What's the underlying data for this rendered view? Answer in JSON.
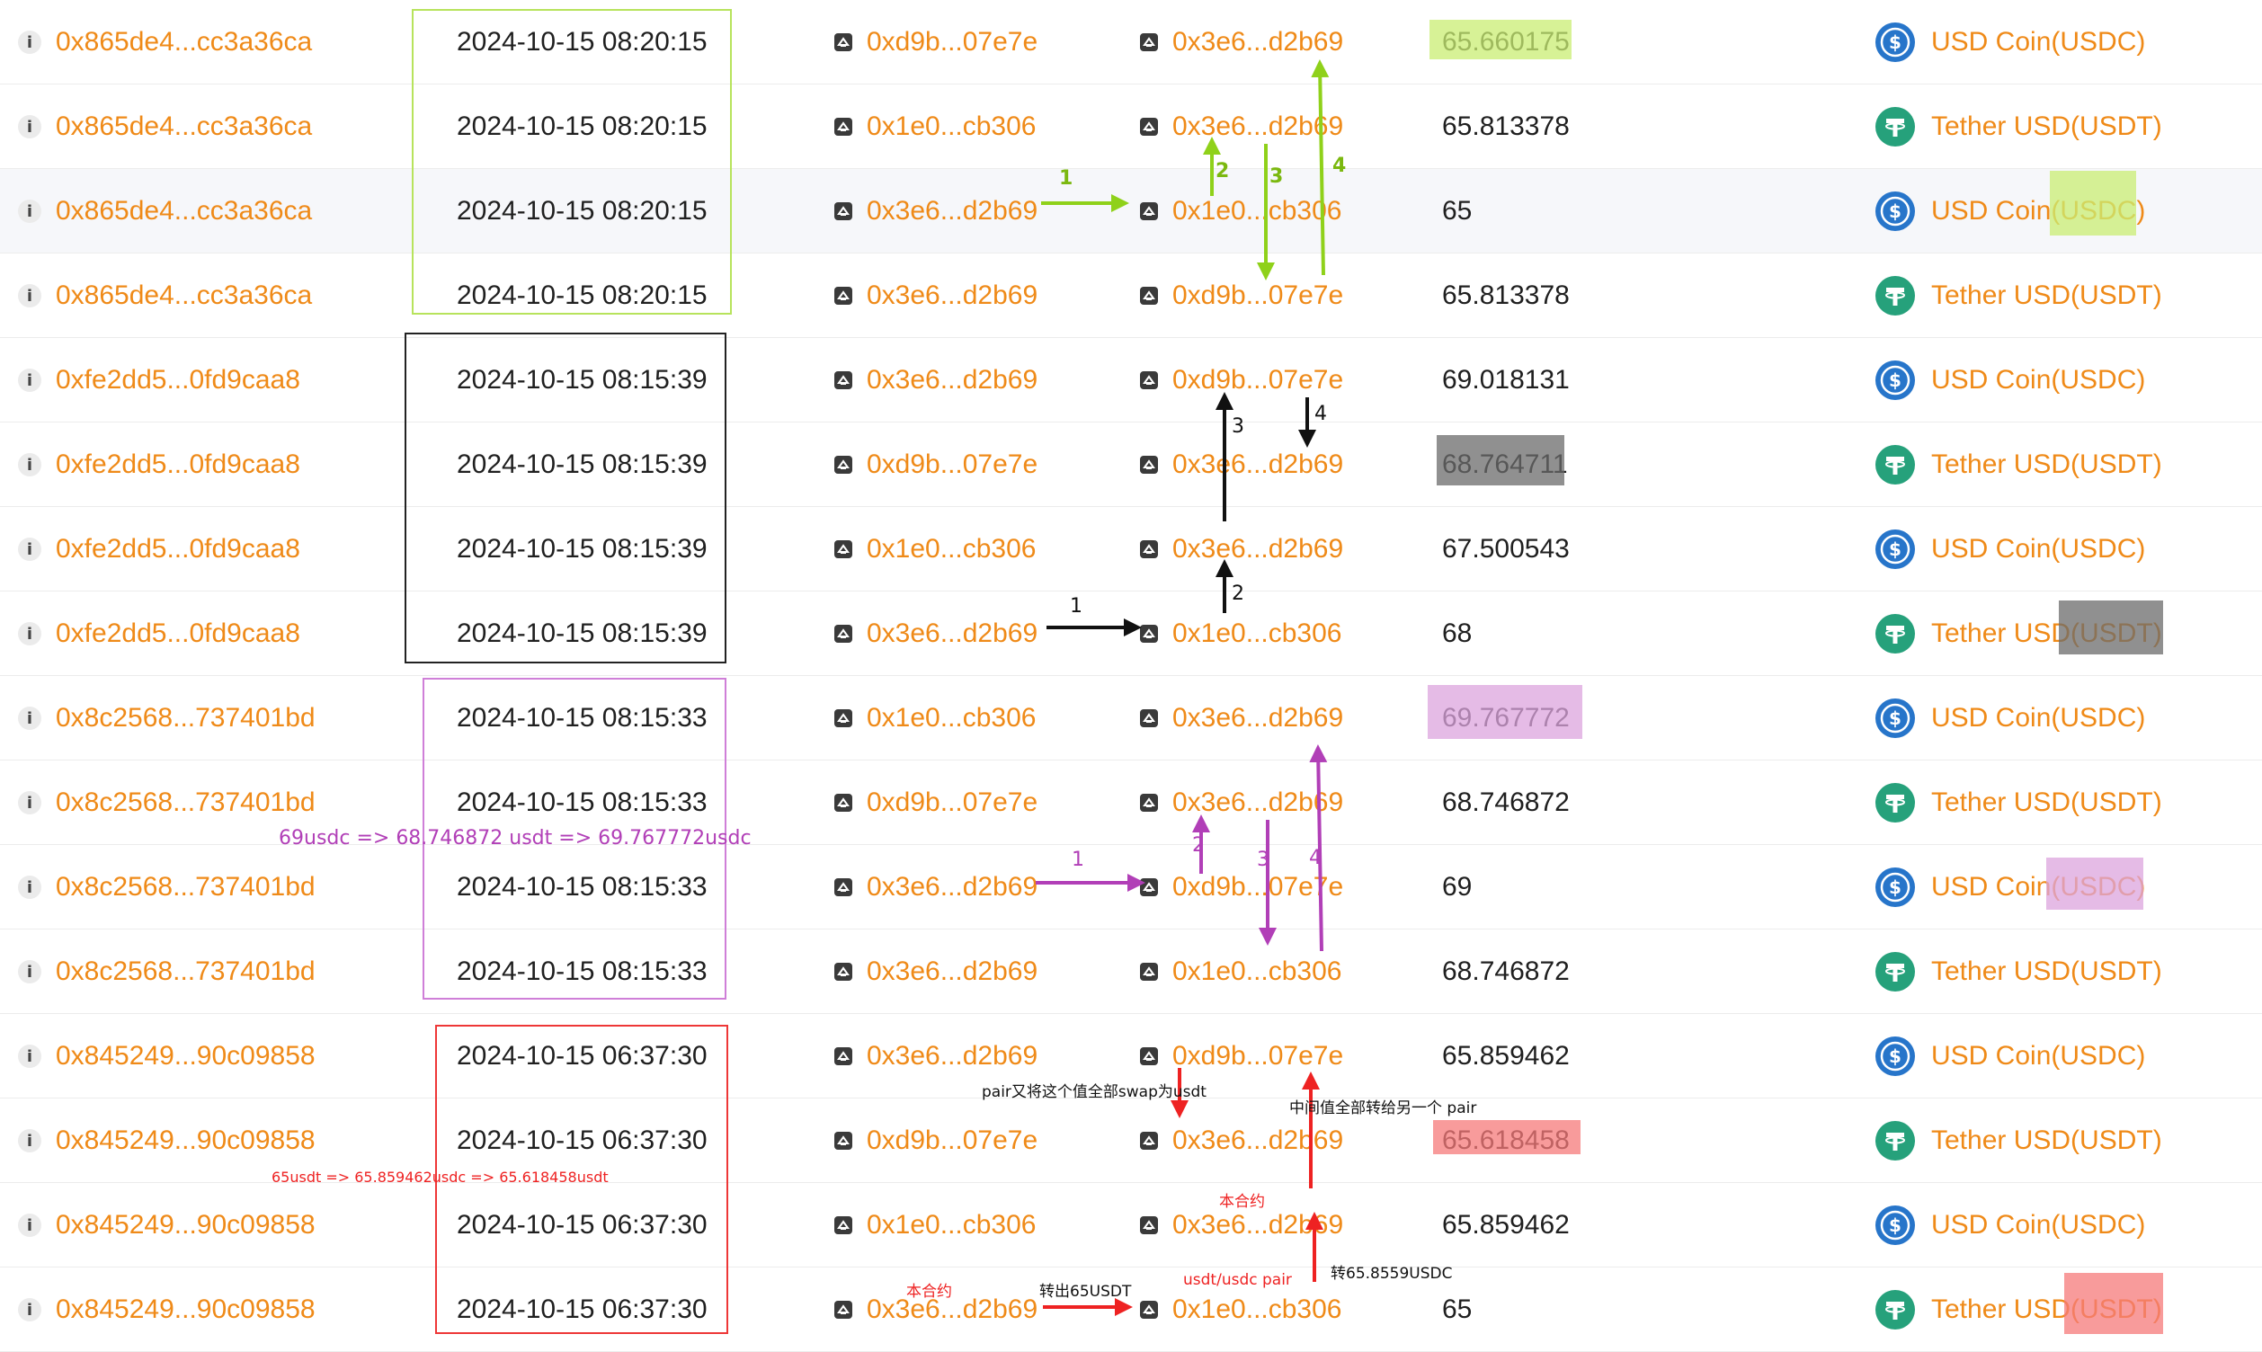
{
  "colors": {
    "link": "#ef8a18",
    "usdc": "#2775ca",
    "usdt": "#26a17b",
    "green_box": "#b7e35c",
    "green_arrow": "#8fd11a",
    "green_fill": "#c9ee73",
    "black_box": "#222222",
    "gray_fill": "#6b6b6b",
    "purple_box": "#cf7fd8",
    "purple_arrow": "#b13fb7",
    "purple_fill": "#dca4de",
    "red_box": "#ee3737",
    "red_arrow": "#ee2222",
    "red_fill": "#f57a7a"
  },
  "icons": {
    "row_info": "info-icon",
    "address": "contract-icon",
    "usdc": "usd-coin-icon",
    "usdt": "tether-icon"
  },
  "rows": [
    {
      "hash": "0x865de4...cc3a36ca",
      "time": "2024-10-15 08:20:15",
      "from": "0xd9b...07e7e",
      "to": "0x3e6...d2b69",
      "value": "65.660175",
      "token": "USD Coin(USDC)",
      "token_type": "usdc"
    },
    {
      "hash": "0x865de4...cc3a36ca",
      "time": "2024-10-15 08:20:15",
      "from": "0x1e0...cb306",
      "to": "0x3e6...d2b69",
      "value": "65.813378",
      "token": "Tether USD(USDT)",
      "token_type": "usdt"
    },
    {
      "hash": "0x865de4...cc3a36ca",
      "time": "2024-10-15 08:20:15",
      "from": "0x3e6...d2b69",
      "to": "0x1e0...cb306",
      "value": "65",
      "token": "USD Coin(USDC)",
      "token_type": "usdc"
    },
    {
      "hash": "0x865de4...cc3a36ca",
      "time": "2024-10-15 08:20:15",
      "from": "0x3e6...d2b69",
      "to": "0xd9b...07e7e",
      "value": "65.813378",
      "token": "Tether USD(USDT)",
      "token_type": "usdt"
    },
    {
      "hash": "0xfe2dd5...0fd9caa8",
      "time": "2024-10-15 08:15:39",
      "from": "0x3e6...d2b69",
      "to": "0xd9b...07e7e",
      "value": "69.018131",
      "token": "USD Coin(USDC)",
      "token_type": "usdc"
    },
    {
      "hash": "0xfe2dd5...0fd9caa8",
      "time": "2024-10-15 08:15:39",
      "from": "0xd9b...07e7e",
      "to": "0x3e6...d2b69",
      "value": "68.764711",
      "token": "Tether USD(USDT)",
      "token_type": "usdt"
    },
    {
      "hash": "0xfe2dd5...0fd9caa8",
      "time": "2024-10-15 08:15:39",
      "from": "0x1e0...cb306",
      "to": "0x3e6...d2b69",
      "value": "67.500543",
      "token": "USD Coin(USDC)",
      "token_type": "usdc"
    },
    {
      "hash": "0xfe2dd5...0fd9caa8",
      "time": "2024-10-15 08:15:39",
      "from": "0x3e6...d2b69",
      "to": "0x1e0...cb306",
      "value": "68",
      "token": "Tether USD(USDT)",
      "token_type": "usdt"
    },
    {
      "hash": "0x8c2568...737401bd",
      "time": "2024-10-15 08:15:33",
      "from": "0x1e0...cb306",
      "to": "0x3e6...d2b69",
      "value": "69.767772",
      "token": "USD Coin(USDC)",
      "token_type": "usdc"
    },
    {
      "hash": "0x8c2568...737401bd",
      "time": "2024-10-15 08:15:33",
      "from": "0xd9b...07e7e",
      "to": "0x3e6...d2b69",
      "value": "68.746872",
      "token": "Tether USD(USDT)",
      "token_type": "usdt"
    },
    {
      "hash": "0x8c2568...737401bd",
      "time": "2024-10-15 08:15:33",
      "from": "0x3e6...d2b69",
      "to": "0xd9b...07e7e",
      "value": "69",
      "token": "USD Coin(USDC)",
      "token_type": "usdc"
    },
    {
      "hash": "0x8c2568...737401bd",
      "time": "2024-10-15 08:15:33",
      "from": "0x3e6...d2b69",
      "to": "0x1e0...cb306",
      "value": "68.746872",
      "token": "Tether USD(USDT)",
      "token_type": "usdt"
    },
    {
      "hash": "0x845249...90c09858",
      "time": "2024-10-15 06:37:30",
      "from": "0x3e6...d2b69",
      "to": "0xd9b...07e7e",
      "value": "65.859462",
      "token": "USD Coin(USDC)",
      "token_type": "usdc"
    },
    {
      "hash": "0x845249...90c09858",
      "time": "2024-10-15 06:37:30",
      "from": "0xd9b...07e7e",
      "to": "0x3e6...d2b69",
      "value": "65.618458",
      "token": "Tether USD(USDT)",
      "token_type": "usdt"
    },
    {
      "hash": "0x845249...90c09858",
      "time": "2024-10-15 06:37:30",
      "from": "0x1e0...cb306",
      "to": "0x3e6...d2b69",
      "value": "65.859462",
      "token": "USD Coin(USDC)",
      "token_type": "usdc"
    },
    {
      "hash": "0x845249...90c09858",
      "time": "2024-10-15 06:37:30",
      "from": "0x3e6...d2b69",
      "to": "0x1e0...cb306",
      "value": "65",
      "token": "Tether USD(USDT)",
      "token_type": "usdt"
    }
  ],
  "annotations": {
    "step_1": "1",
    "step_2": "2",
    "step_3": "3",
    "step_4": "4",
    "purple_summary": "69usdc => 68.746872 usdt => 69.767772usdc",
    "red_summary": "65usdt => 65.859462usdc => 65.618458usdt",
    "pair_swap_back": "pair又将这个值全部swap为usdt",
    "transfer_middle": "中间值全部转给另一个 pair",
    "this_contract_top": "本合约",
    "this_contract_bottom": "本合约",
    "sent_65usdt": "转出65USDT",
    "usdt_usdc_pair": "usdt/usdc pair",
    "sent_65_8559": "转65.8559USDC"
  }
}
